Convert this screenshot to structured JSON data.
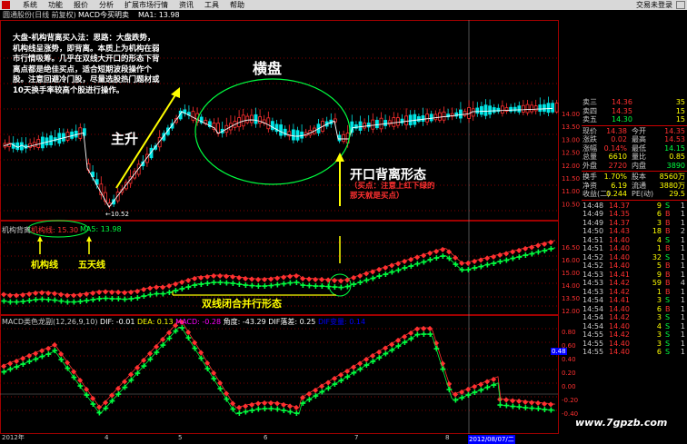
{
  "menu": {
    "items": [
      "系统",
      "功能",
      "报价",
      "分析",
      "扩展市场行情",
      "资讯",
      "工具",
      "帮助"
    ],
    "login": "交易未登录"
  },
  "header": {
    "stock_name": "圆通股份(日线 前复权)",
    "indicator": "MACD今买明卖",
    "ma1": "MA1: 13.98"
  },
  "main_chart": {
    "description": "大盘-机构背离买入法：思路：大盘跌势，机构线呈涨势，即背离。本质上为机构在弱市行情吸筹。几乎在双线大开口的形态下背离点都是绝佳买点，适合短期波段操作个股。注意回避冷门股，尽量选股热门题材或10天换手率较高个股进行操作。",
    "label_horizontal": "横盘",
    "label_rise": "主升",
    "label_low": "10.52",
    "label_gap": "开口背离形态",
    "label_buy": "（买点：注意上红下绿的那天就是买点）",
    "y_ticks": [
      "14.00",
      "13.50",
      "13.00",
      "12.50",
      "12.00",
      "11.50",
      "11.00",
      "10.50"
    ]
  },
  "mid_chart": {
    "legend_name": "机构背离",
    "legend_jg": "机构线: 15.30",
    "legend_ma5": "MA5: 13.98",
    "label_jg": "机构线",
    "label_ma5": "五天线",
    "label_parallel": "双线闭合并行形态",
    "y_ticks": [
      "16.50",
      "16.00",
      "15.00",
      "14.00",
      "13.50",
      "12.00"
    ]
  },
  "macd_chart": {
    "legend": "MACD类色龙副(12,26,9,10)",
    "dif": "DIF: -0.01",
    "dea": "DEA: 0.13",
    "macd": "MACD: -0.28",
    "angle": "角度: -43.29",
    "dif_diff": "DIF落差: 0.25",
    "dif_change": "DIF变量: 0.14",
    "current_value": "0.48",
    "y_ticks": [
      "0.80",
      "0.60",
      "0.40",
      "0.20",
      "0.00",
      "-0.20",
      "-0.40"
    ]
  },
  "date_axis": {
    "labels": [
      "2012年",
      "4",
      "5",
      "6",
      "7",
      "8"
    ],
    "current_date": "2012/08/07/二"
  },
  "quote_panel": {
    "asks": [
      {
        "label": "卖三",
        "price": "14.36",
        "vol": "35"
      },
      {
        "label": "卖四",
        "price": "14.35",
        "vol": "15"
      },
      {
        "label": "卖五",
        "price": "14.30",
        "vol": "15"
      }
    ],
    "stats_top": [
      {
        "l1": "现价",
        "v1": "14.38",
        "l2": "今开",
        "v2": "14.35"
      },
      {
        "l1": "涨跌",
        "v1": "0.02",
        "l2": "最高",
        "v2": "14.53"
      },
      {
        "l1": "涨幅",
        "v1": "0.14%",
        "l2": "最低",
        "v2": "14.15"
      },
      {
        "l1": "总量",
        "v1": "6610",
        "l2": "量比",
        "v2": "0.85"
      },
      {
        "l1": "外盘",
        "v1": "2720",
        "l2": "内盘",
        "v2": "3890"
      }
    ],
    "stats_bottom": [
      {
        "l1": "换手",
        "v1": "1.70%",
        "l2": "股本",
        "v2": "8560万"
      },
      {
        "l1": "净资",
        "v1": "6.19",
        "l2": "流通",
        "v2": "3880万"
      },
      {
        "l1": "收益(二)",
        "v1": "0.244",
        "l2": "PE(动)",
        "v2": "29.5"
      }
    ],
    "ticks": [
      {
        "t": "14:48",
        "p": "14.37",
        "v": "9",
        "s": "S",
        "n": "1"
      },
      {
        "t": "14:49",
        "p": "14.35",
        "v": "6",
        "s": "B",
        "n": "1"
      },
      {
        "t": "14:49",
        "p": "14.37",
        "v": "3",
        "s": "B",
        "n": "1"
      },
      {
        "t": "14:50",
        "p": "14.43",
        "v": "18",
        "s": "B",
        "n": "2"
      },
      {
        "t": "14:51",
        "p": "14.40",
        "v": "4",
        "s": "S",
        "n": "1"
      },
      {
        "t": "14:51",
        "p": "14.40",
        "v": "1",
        "s": "B",
        "n": "1"
      },
      {
        "t": "14:52",
        "p": "14.40",
        "v": "32",
        "s": "S",
        "n": "1"
      },
      {
        "t": "14:52",
        "p": "14.40",
        "v": "5",
        "s": "B",
        "n": "1"
      },
      {
        "t": "14:53",
        "p": "14.41",
        "v": "9",
        "s": "B",
        "n": "1"
      },
      {
        "t": "14:53",
        "p": "14.42",
        "v": "59",
        "s": "B",
        "n": "4"
      },
      {
        "t": "14:53",
        "p": "14.42",
        "v": "1",
        "s": "B",
        "n": "1"
      },
      {
        "t": "14:54",
        "p": "14.41",
        "v": "3",
        "s": "S",
        "n": "1"
      },
      {
        "t": "14:54",
        "p": "14.40",
        "v": "6",
        "s": "B",
        "n": "1"
      },
      {
        "t": "14:54",
        "p": "14.42",
        "v": "3",
        "s": "S",
        "n": "1"
      },
      {
        "t": "14:54",
        "p": "14.40",
        "v": "4",
        "s": "S",
        "n": "1"
      },
      {
        "t": "14:55",
        "p": "14.42",
        "v": "3",
        "s": "S",
        "n": "1"
      },
      {
        "t": "14:55",
        "p": "14.40",
        "v": "3",
        "s": "S",
        "n": "1"
      },
      {
        "t": "14:55",
        "p": "14.40",
        "v": "6",
        "s": "S",
        "n": "1"
      }
    ]
  },
  "watermark": "www.7gpzb.com",
  "colors": {
    "up": "#ff3030",
    "down": "#00e5e5",
    "green": "#00ff40",
    "accent_yellow": "#ffff00",
    "grid_red": "#800000"
  }
}
